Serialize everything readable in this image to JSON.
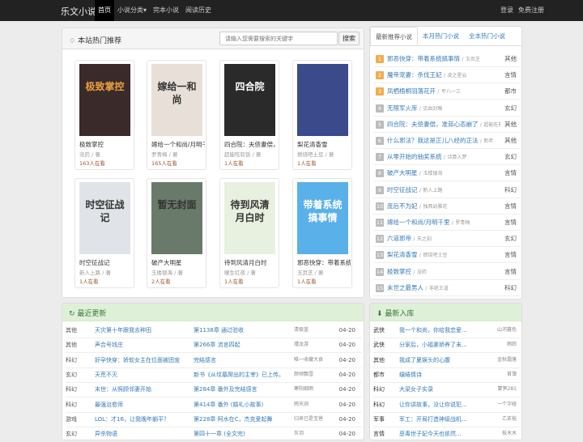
{
  "header": {
    "logo": "乐文小说",
    "nav": [
      "首页",
      "小说分类▾",
      "完本小说",
      "阅读历史"
    ],
    "login": "登录",
    "register": "免费注册"
  },
  "hot": {
    "title": "本站热门推荐",
    "search_placeholder": "请输入您需要搜索的关键字",
    "search_button": "搜索",
    "books": [
      {
        "title": "极致掌控",
        "author": "没药 / 著",
        "readers": "163人在看",
        "cover_text": "极致掌控",
        "cover_color": "#3a2a2a"
      },
      {
        "title": "嫁给一个和尚/月明千",
        "author": "罗青梅 / 著",
        "readers": "165人在看",
        "cover_text": "嫁给一和尚",
        "cover_color": "#e8e0d8"
      },
      {
        "title": "四合院：夫债妻偿，开",
        "author": "超能吃软饭 / 著",
        "readers": "1人在看",
        "cover_text": "四合院",
        "cover_color": "#2a2a2a"
      },
      {
        "title": "梨花清香雪",
        "author": "燃烧吧土豆 / 著",
        "readers": "1人在看",
        "cover_text": "",
        "cover_color": "#3a4a8a"
      },
      {
        "title": "时空征战记",
        "author": "新人上路 / 著",
        "readers": "1人在看",
        "cover_text": "时空征战记",
        "cover_color": "#e0e4e8"
      },
      {
        "title": "破产大明星",
        "author": "玉楼银海 / 著",
        "readers": "2人在看",
        "cover_text": "暂无封面",
        "cover_color": "#6a7a6a"
      },
      {
        "title": "待到风清月白时",
        "author": "暖生红夜 / 著",
        "readers": "1人在看",
        "cover_text": "待到风清月白时",
        "cover_color": "#e8f0e0"
      },
      {
        "title": "邪恶快穿：带着系统",
        "author": "玉页芝 / 著",
        "readers": "1人在看",
        "cover_text": "带着系统搞事情",
        "cover_color": "#5ab0e8"
      }
    ]
  },
  "tabs": {
    "labels": [
      "最新推荐小说",
      "本月热门小说",
      "全本热门小说"
    ]
  },
  "ranking": [
    {
      "num": "1",
      "title": "邪恶快穿：带着系统搞事情",
      "author": "玉页芝",
      "cat": "其他"
    },
    {
      "num": "2",
      "title": "魔帝宠妻：杀伐王妃",
      "author": "凌之星云",
      "cat": "言情"
    },
    {
      "num": "3",
      "title": "凤栖梧桐羽落花开",
      "author": "平八一三",
      "cat": "都市"
    },
    {
      "num": "4",
      "title": "无限军火库",
      "author": "见血封喉",
      "cat": "玄幻"
    },
    {
      "num": "5",
      "title": "四合院：夫债妻偿，准茹心态崩了",
      "author": "超能吃软饭",
      "cat": "其他"
    },
    {
      "num": "6",
      "title": "什么邪法？我这是正儿八经的正法",
      "author": "新年",
      "cat": "其他"
    },
    {
      "num": "7",
      "title": "从零开始的抽奖系统",
      "author": "诗算入梦",
      "cat": "玄幻"
    },
    {
      "num": "8",
      "title": "破产大明星",
      "author": "玉楼银海",
      "cat": "言情"
    },
    {
      "num": "9",
      "title": "时空征战记",
      "author": "新人上路",
      "cat": "科幻"
    },
    {
      "num": "10",
      "title": "庞后不为妃",
      "author": "独具幼雅花",
      "cat": "言情"
    },
    {
      "num": "11",
      "title": "嫁给一个和尚/月明千里",
      "author": "罗青梅",
      "cat": "言情"
    },
    {
      "num": "12",
      "title": "六道邪帝",
      "author": "天之刻",
      "cat": "玄幻"
    },
    {
      "num": "13",
      "title": "梨花清香雪",
      "author": "燃烧吧土豆",
      "cat": "言情"
    },
    {
      "num": "14",
      "title": "极致掌控",
      "author": "没药",
      "cat": "言情"
    },
    {
      "num": "15",
      "title": "末世之最男人",
      "author": "非绝王道",
      "cat": "科幻"
    }
  ],
  "updates": {
    "title": "最近更新",
    "rows": [
      {
        "cat": "其他",
        "book": "天灾第十年跟我去种田",
        "chap": "第1138章 通过验收",
        "author": "清极蓝",
        "date": "04-20"
      },
      {
        "cat": "其他",
        "book": "声合号钱庄",
        "chap": "第266章 流言四起",
        "author": "瑾龙游",
        "date": "04-20"
      },
      {
        "cat": "科幻",
        "book": "好孕快穿：娇软女主在位面被团宠",
        "chap": "完结感言",
        "author": "唯一收藏大食",
        "date": "04-20"
      },
      {
        "cat": "玄幻",
        "book": "天荒不灭",
        "chap": "新书《从坟墓爬出的主宰》已上传。",
        "author": "颜倾飘雪",
        "date": "04-20"
      },
      {
        "cat": "科幻",
        "book": "末世：从照顾邻妻开始",
        "chap": "第284章 番外及完结感言",
        "author": "寒阳细雨",
        "date": "04-20"
      },
      {
        "cat": "科幻",
        "book": "最强治愈师",
        "chap": "第414章 番外 (婚礼小故事)",
        "author": "雨天涧",
        "date": "04-20"
      },
      {
        "cat": "游戏",
        "book": "LOL：才16，让我晚年躺平？",
        "chap": "第228章 阿水在C，杰克爱起舞",
        "author": "归来已是宝爸",
        "date": "04-20"
      },
      {
        "cat": "玄幻",
        "book": "异杀物语",
        "chap": "第四十一章 (全文完)",
        "author": "灰羽",
        "date": "04-20"
      }
    ]
  },
  "library": {
    "title": "最新入库",
    "rows": [
      {
        "cat": "武侠",
        "book": "我一个和尚，你给我恋爱...",
        "author": "山河暮色"
      },
      {
        "cat": "武侠",
        "book": "分家后，小福妻娇养了未...",
        "author": "雨踪"
      },
      {
        "cat": "其他",
        "book": "我成了夏娱头的心腹",
        "author": "金秋霜落"
      },
      {
        "cat": "都市",
        "book": "缱绻情诗",
        "author": "首簿"
      },
      {
        "cat": "科幻",
        "book": "大梁女子实录",
        "author": "蒙笋281"
      },
      {
        "cat": "科幻",
        "book": "让你讲故事，没让你说犯...",
        "author": "一个字碰"
      },
      {
        "cat": "军事",
        "book": "军工：开局打造神级战机...",
        "author": "乙亥裕"
      },
      {
        "cat": "言情",
        "book": "恶毒世子妃今天也依然...",
        "author": "枝木木"
      }
    ]
  },
  "colors": {
    "topbar": "#222222",
    "link": "#337ab7",
    "rank_top": "#f0ad4e",
    "rank_other": "#bbbbbb",
    "green_head": "#dff0d8"
  }
}
